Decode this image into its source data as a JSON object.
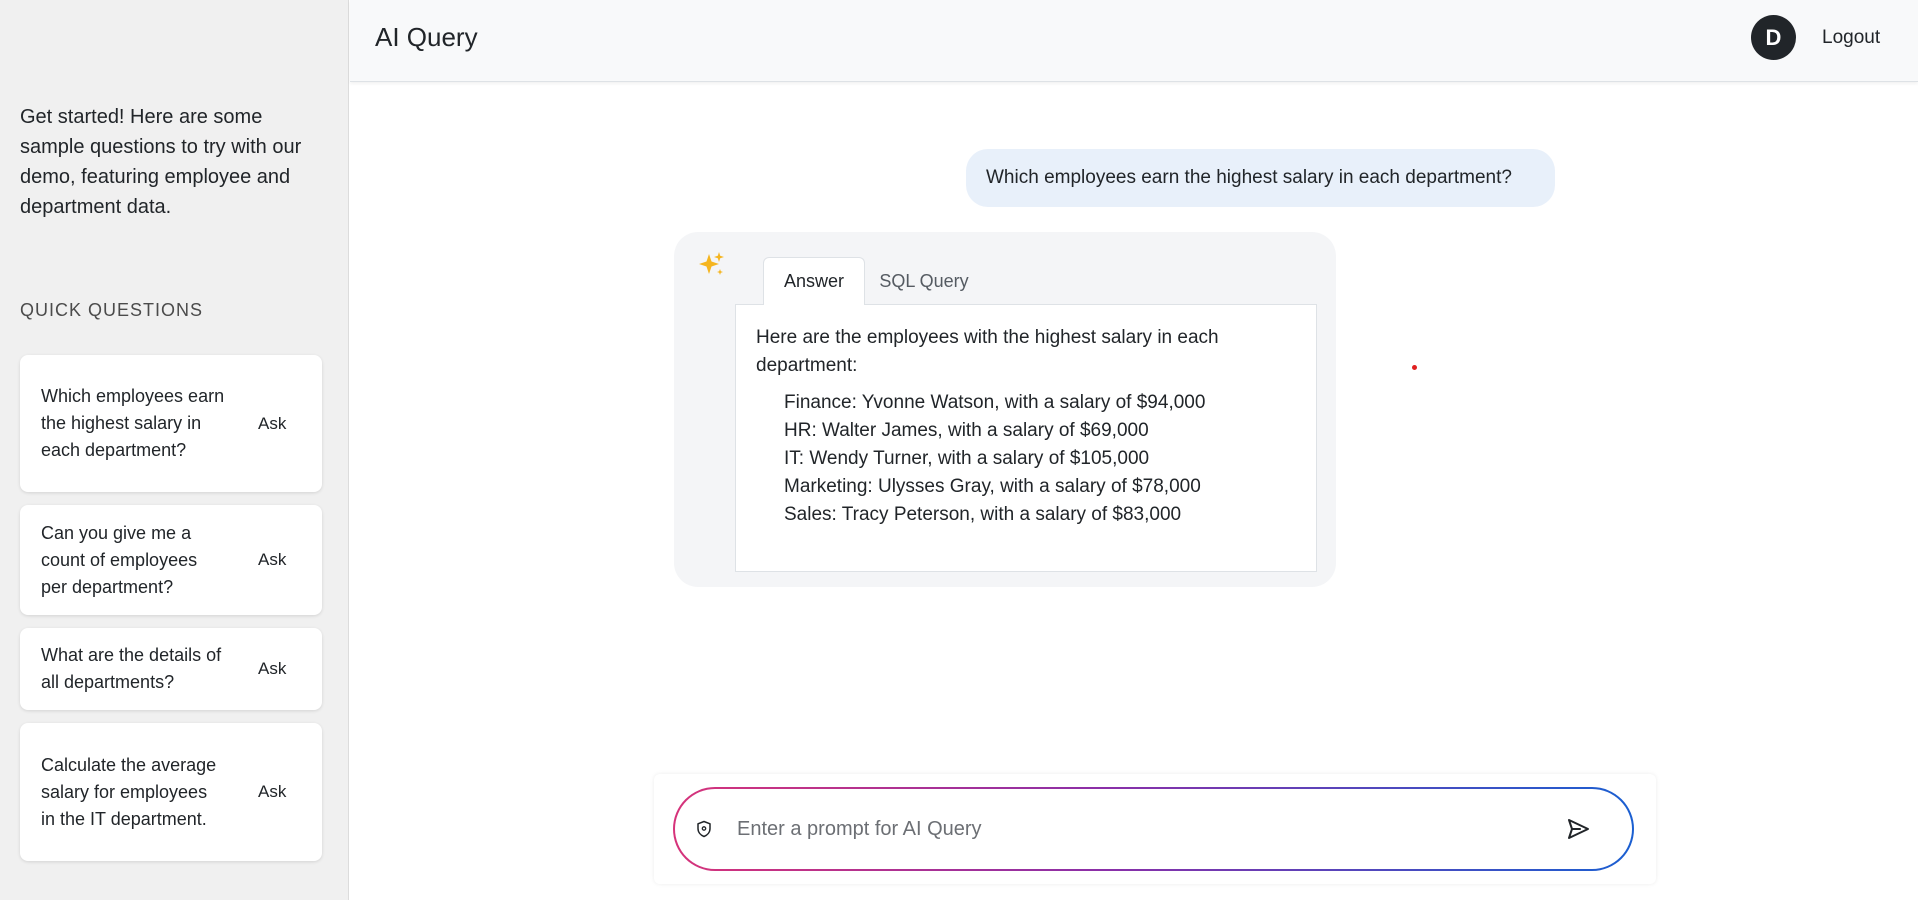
{
  "header": {
    "title": "AI Query",
    "avatar_initial": "D",
    "logout_label": "Logout"
  },
  "sidebar": {
    "intro": "Get started! Here are some sample questions to try with our demo, featuring employee and department data.",
    "heading": "QUICK QUESTIONS",
    "questions": [
      {
        "text": "Which employees earn the highest salary in each department?",
        "action": "Ask"
      },
      {
        "text": "Can you give me a count of employees per department?",
        "action": "Ask"
      },
      {
        "text": "What are the details of all departments?",
        "action": "Ask"
      },
      {
        "text": "Calculate the average salary for employees in the IT department.",
        "action": "Ask"
      }
    ]
  },
  "chat": {
    "user_message": "Which employees earn the highest salary in each department?",
    "tabs": [
      {
        "label": "Answer",
        "active": true
      },
      {
        "label": "SQL Query",
        "active": false
      }
    ],
    "answer_intro": "Here are the employees with the highest salary in each department:",
    "answer_items": [
      "Finance: Yvonne Watson, with a salary of $94,000",
      "HR: Walter James, with a salary of $69,000",
      "IT: Wendy Turner, with a salary of $105,000",
      "Marketing: Ulysses Gray, with a salary of $78,000",
      "Sales: Tracy Peterson, with a salary of $83,000"
    ]
  },
  "prompt": {
    "placeholder": "Enter a prompt for AI Query",
    "value": ""
  },
  "icons": {
    "assistant": "sparkles-icon",
    "prompt_left": "shield-icon",
    "send": "send-icon"
  },
  "colors": {
    "sidebar_bg": "#f0f0f0",
    "user_bubble_bg": "#e8f0fa",
    "gradient_start": "#d6337a",
    "gradient_end": "#1a5fd1",
    "avatar_bg": "#212529"
  }
}
